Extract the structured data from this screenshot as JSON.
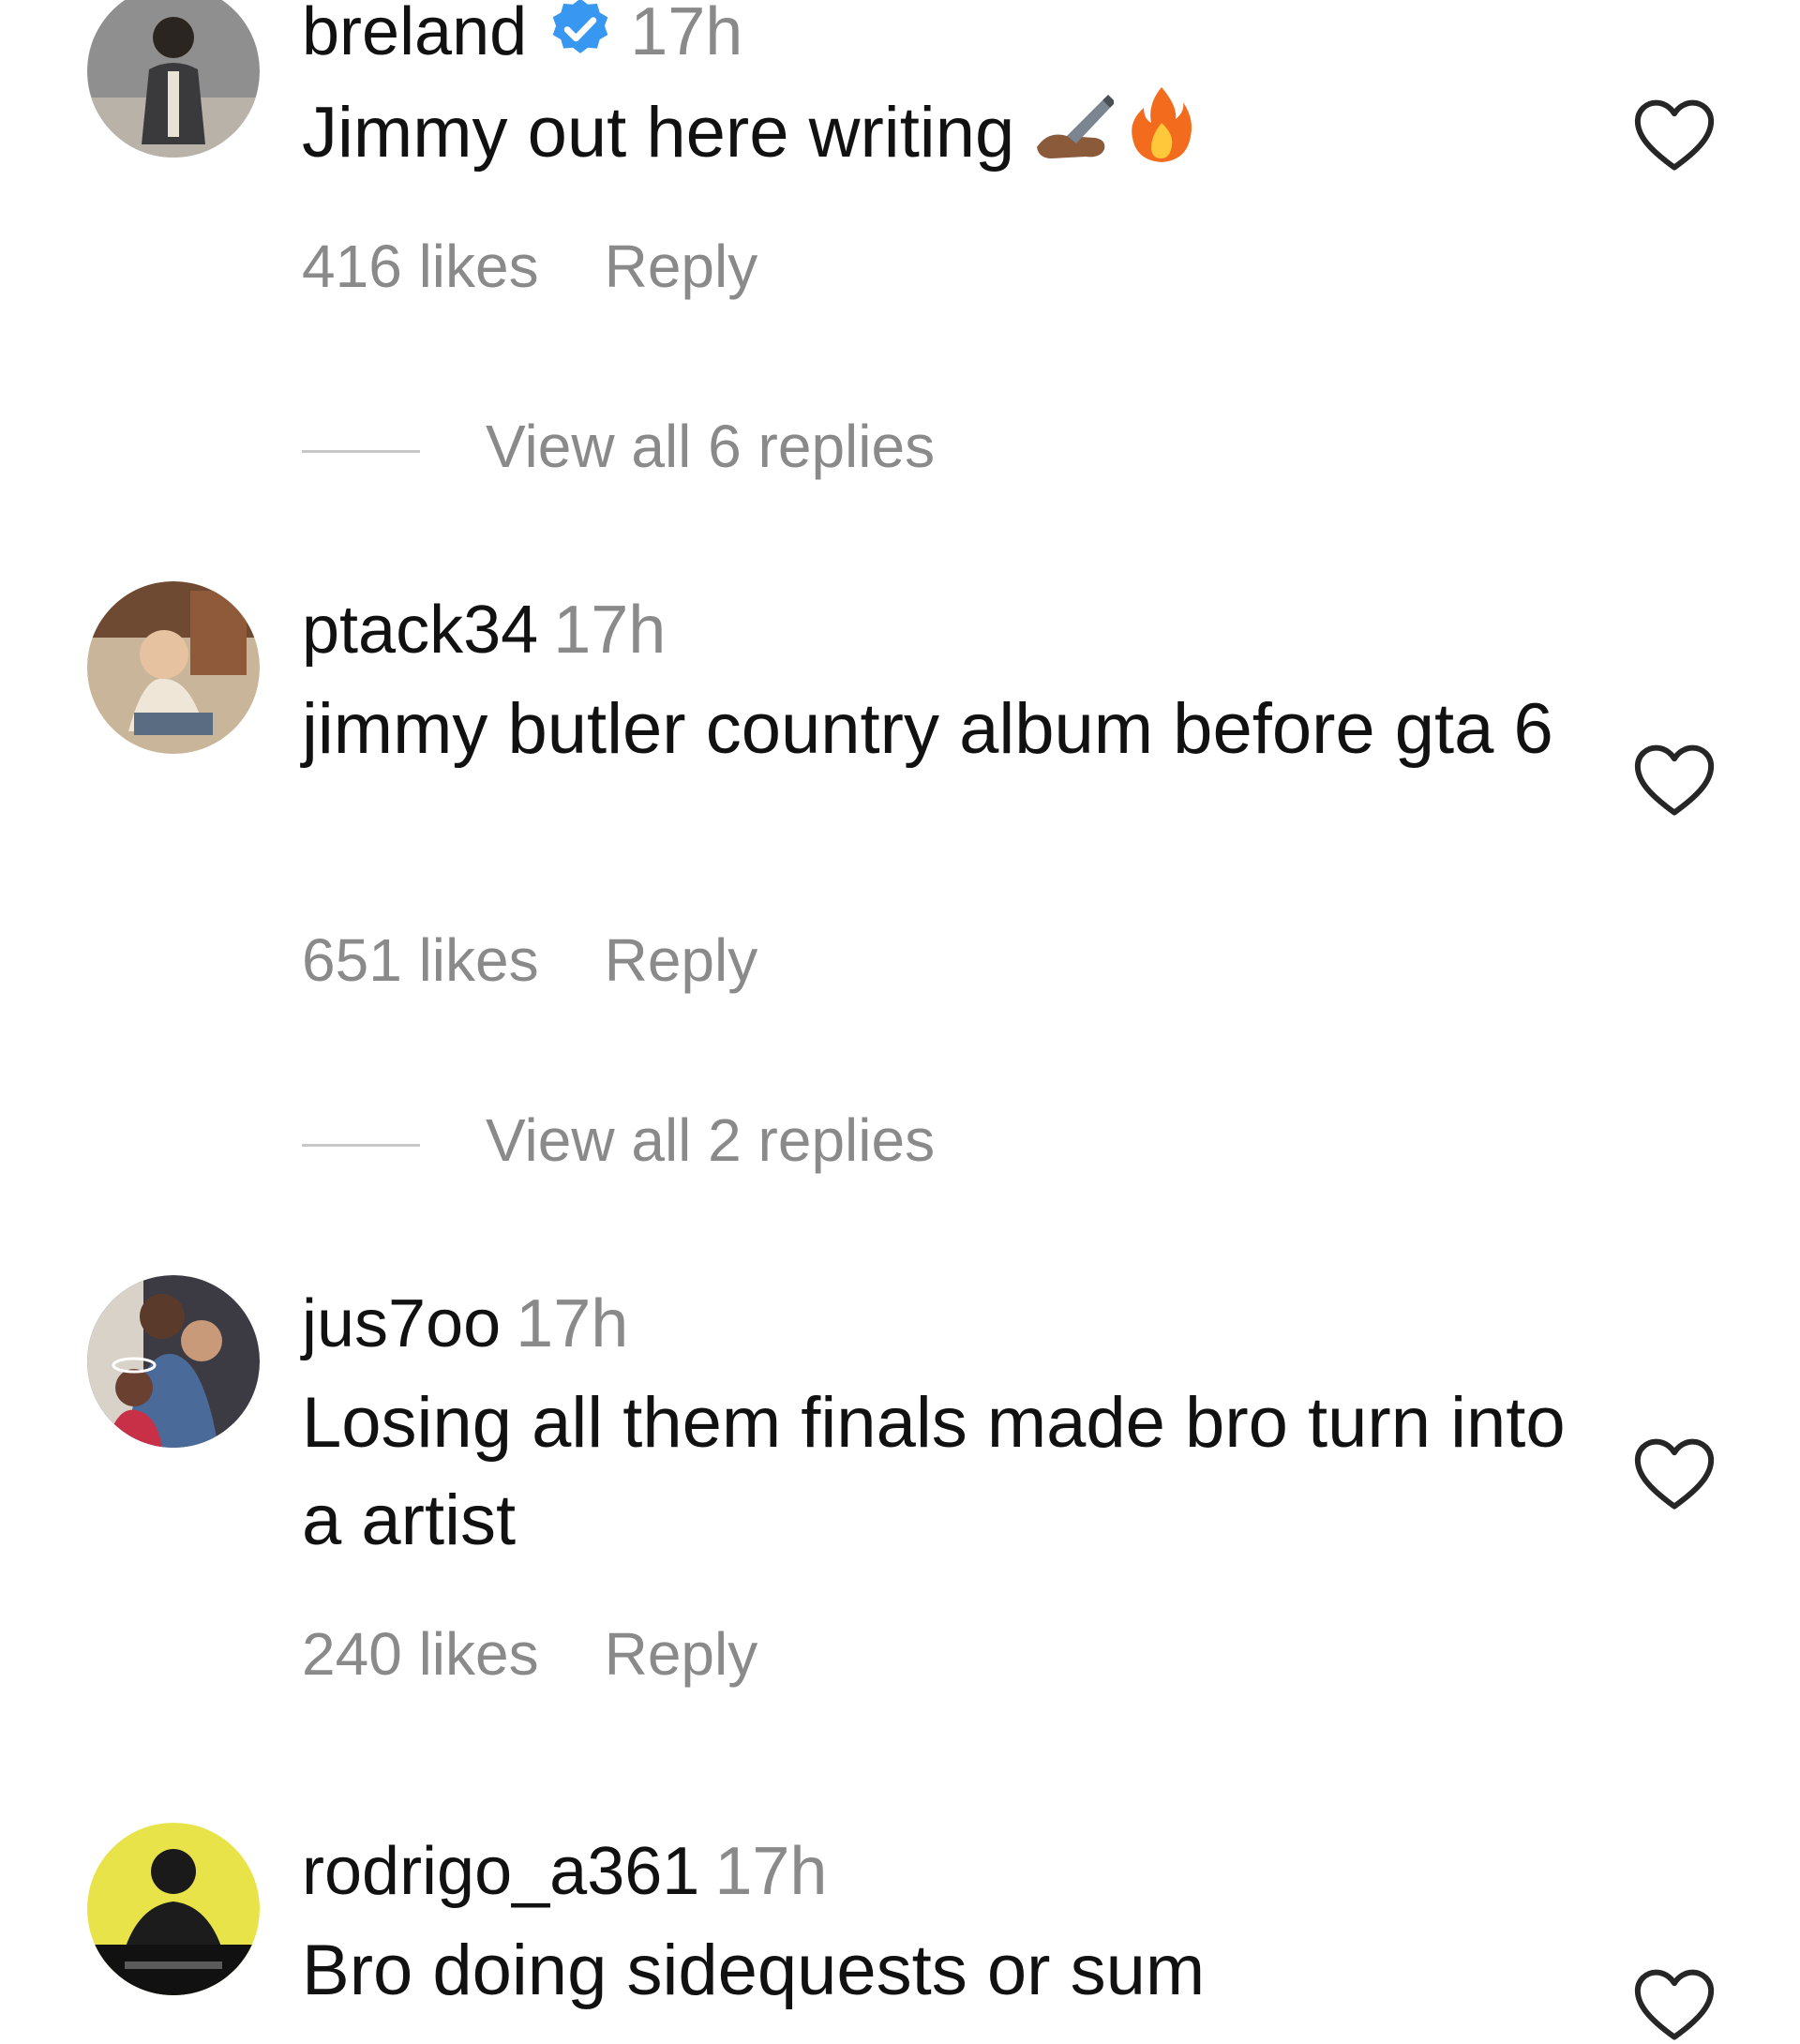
{
  "comments": [
    {
      "username": "breland",
      "verified": true,
      "time": "17h",
      "text": "Jimmy out here writing",
      "emoji_icons": [
        "writing-hand-icon",
        "fire-icon"
      ],
      "likes": "416 likes",
      "reply": "Reply",
      "view_replies": "View all 6 replies"
    },
    {
      "username": "ptack34",
      "verified": false,
      "time": "17h",
      "text": "jimmy butler country album before gta 6",
      "likes": "651 likes",
      "reply": "Reply",
      "view_replies": "View all 2 replies"
    },
    {
      "username": "jus7oo",
      "verified": false,
      "time": "17h",
      "text": "Losing all them finals made bro turn into a artist",
      "likes": "240 likes",
      "reply": "Reply"
    },
    {
      "username": "rodrigo_a361",
      "verified": false,
      "time": "17h",
      "text": "Bro doing sidequests or sum"
    }
  ],
  "colors": {
    "text": "#111111",
    "muted": "#8a8a8a",
    "verified_blue": "#3897f0",
    "divider": "#c8c8c8"
  },
  "icons": {
    "like": "heart-outline-icon",
    "verified": "verified-badge-icon"
  }
}
